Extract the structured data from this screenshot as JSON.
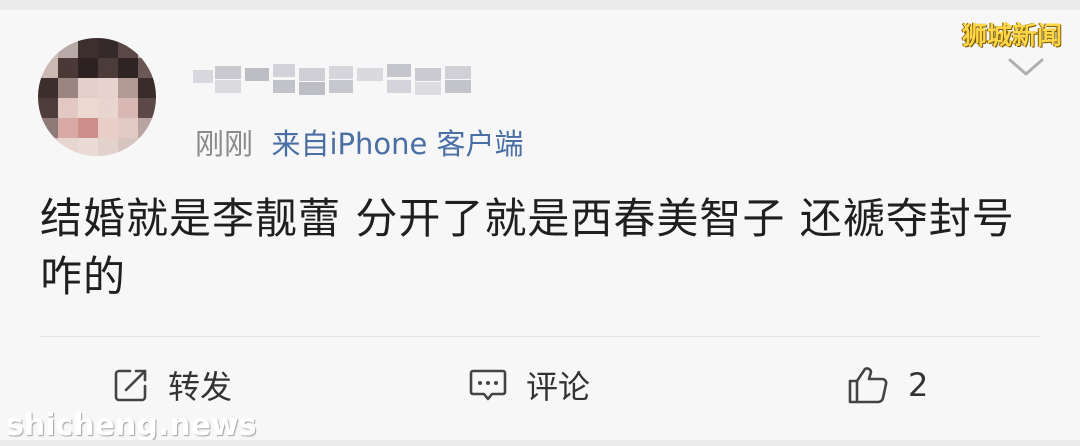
{
  "post": {
    "time": "刚刚",
    "source": "来自iPhone 客户端",
    "content": "结婚就是李靓蕾 分开了就是西春美智子 还褫夺封号咋的"
  },
  "actions": {
    "repost_label": "转发",
    "comment_label": "评论",
    "like_count": "2"
  },
  "icons": {
    "repost": "edit-share-icon",
    "comment": "comment-icon",
    "like": "thumbs-up-icon",
    "more": "chevron-down-icon"
  },
  "watermarks": {
    "top_right": "狮城新闻",
    "bottom_left": "shicheng.news"
  },
  "colors": {
    "source_link": "#4a6fa5",
    "watermark": "#ffd54a"
  }
}
